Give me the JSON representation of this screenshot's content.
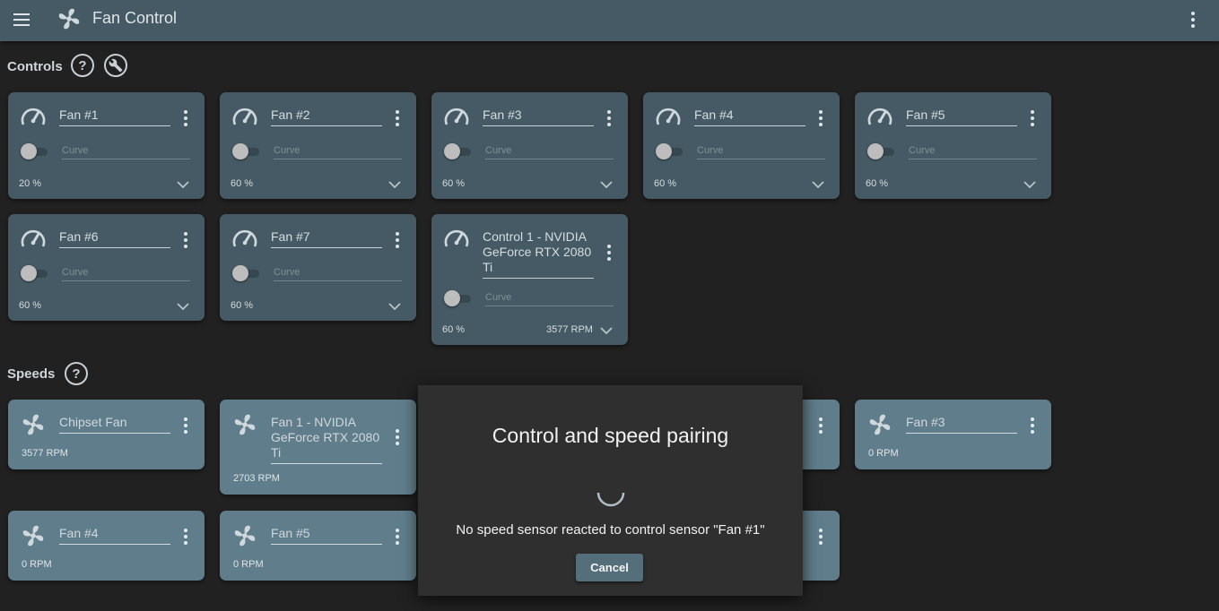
{
  "app": {
    "title": "Fan Control"
  },
  "sections": {
    "controls": "Controls",
    "speeds": "Speeds",
    "help": "?"
  },
  "controls": [
    {
      "name": "Fan #1",
      "curve_placeholder": "Curve",
      "percent": "20 %"
    },
    {
      "name": "Fan #2",
      "curve_placeholder": "Curve",
      "percent": "60 %"
    },
    {
      "name": "Fan #3",
      "curve_placeholder": "Curve",
      "percent": "60 %"
    },
    {
      "name": "Fan #4",
      "curve_placeholder": "Curve",
      "percent": "60 %"
    },
    {
      "name": "Fan #5",
      "curve_placeholder": "Curve",
      "percent": "60 %"
    },
    {
      "name": "Fan #6",
      "curve_placeholder": "Curve",
      "percent": "60 %"
    },
    {
      "name": "Fan #7",
      "curve_placeholder": "Curve",
      "percent": "60 %"
    },
    {
      "name": "Control 1 - NVIDIA GeForce RTX 2080 Ti",
      "name_lines": [
        "Control 1 - NVIDIA",
        "GeForce RTX 2080",
        "Ti"
      ],
      "curve_placeholder": "Curve",
      "percent": "60 %",
      "rpm": "3577 RPM"
    }
  ],
  "speeds": [
    {
      "name": "Chipset Fan",
      "rpm": "3577 RPM"
    },
    {
      "name": "Fan 1 - NVIDIA GeForce RTX 2080 Ti",
      "name_lines": [
        "Fan 1 - NVIDIA",
        "GeForce RTX 2080",
        "Ti"
      ],
      "rpm": "2703 RPM"
    },
    {
      "name": "Fan #3",
      "rpm": "0 RPM"
    },
    {
      "name": "Fan #4",
      "rpm": "0 RPM"
    },
    {
      "name": "Fan #5",
      "rpm": "0 RPM"
    }
  ],
  "dialog": {
    "title": "Control and speed pairing",
    "message": "No speed sensor reacted to control sensor \"Fan #1\"",
    "cancel_label": "Cancel"
  },
  "colors": {
    "appbar": "#455a64",
    "control_card": "#455a64",
    "speed_card": "#607d8b",
    "background": "#212121",
    "dialog": "#2f2f2f",
    "button": "#546e7a"
  },
  "icons": {
    "menu": "hamburger-menu-icon",
    "logo": "fan-icon",
    "overflow": "dots-vertical-icon",
    "control": "gauge-icon",
    "speed": "fan-icon",
    "tools": "wrench-icon",
    "help": "help-circle-icon",
    "expand": "chevron-down-icon"
  }
}
